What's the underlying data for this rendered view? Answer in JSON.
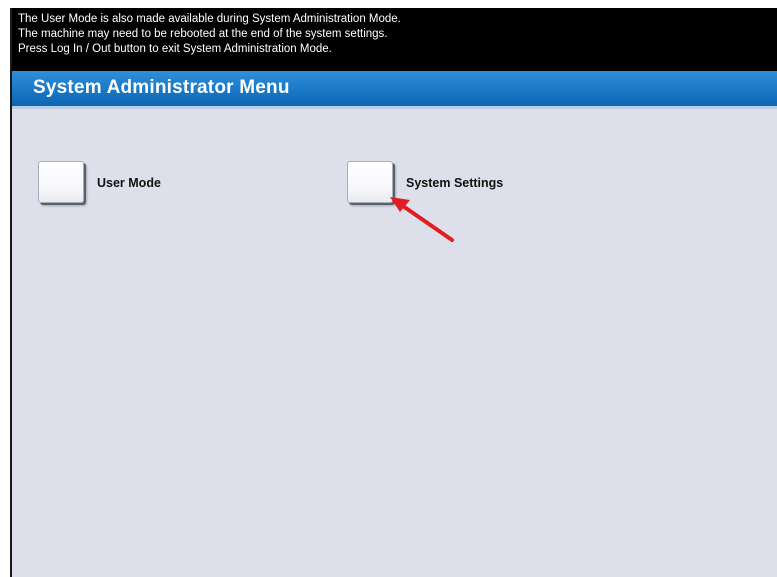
{
  "message_bar": {
    "lines": [
      "The User Mode is also made available during System Administration Mode.",
      "The machine may need to be rebooted at the end of the system settings.",
      "Press Log In / Out button to exit System Administration Mode."
    ]
  },
  "header": {
    "title": "System Administrator Menu"
  },
  "menu": {
    "options": [
      {
        "label": "User Mode"
      },
      {
        "label": "System Settings"
      }
    ]
  },
  "annotation": {
    "arrow_color": "#e31b23",
    "arrow_icon": "red-arrow-icon"
  },
  "colors": {
    "title_bar": "#1a78c6",
    "screen_background": "#dde0ea",
    "message_background": "#000000"
  }
}
